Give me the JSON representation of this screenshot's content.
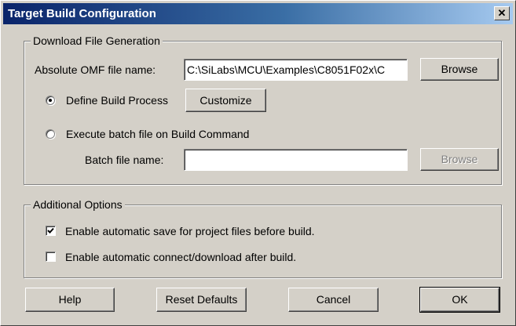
{
  "window": {
    "title": "Target Build Configuration",
    "close_glyph": "✕"
  },
  "download_group": {
    "legend": "Download File Generation",
    "omf_label": "Absolute OMF file name:",
    "omf_value": "C:\\SiLabs\\MCU\\Examples\\C8051F02x\\C",
    "browse_label": "Browse",
    "define_build_label": "Define Build Process",
    "define_build_selected": true,
    "customize_label": "Customize",
    "execute_batch_label": "Execute batch file on Build Command",
    "execute_batch_selected": false,
    "batch_label": "Batch file name:",
    "batch_value": "",
    "batch_browse_label": "Browse"
  },
  "options_group": {
    "legend": "Additional Options",
    "auto_save_label": "Enable automatic save for project files before build.",
    "auto_save_checked": true,
    "auto_connect_label": "Enable automatic connect/download after build.",
    "auto_connect_checked": false
  },
  "footer": {
    "help_label": "Help",
    "reset_label": "Reset Defaults",
    "cancel_label": "Cancel",
    "ok_label": "OK"
  }
}
